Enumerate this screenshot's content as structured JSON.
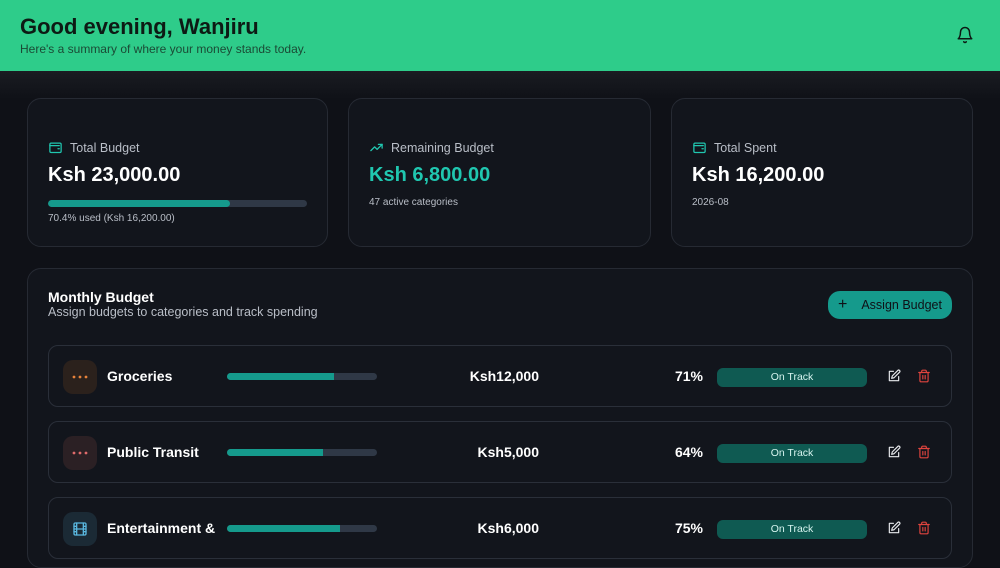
{
  "header": {
    "greeting": "Good evening, Wanjiru",
    "subtitle": "Here's a summary of where your money stands today."
  },
  "cards": [
    {
      "label": "Total Budget",
      "amount": "Ksh 23,000.00",
      "progress_pct": 70.4,
      "sub": "70.4% used (Ksh 16,200.00)",
      "icon": "wallet-icon"
    },
    {
      "label": "Remaining Budget",
      "amount": "Ksh 6,800.00",
      "sub": "47 active categories",
      "icon": "trending-up-icon"
    },
    {
      "label": "Total Spent",
      "amount": "Ksh 16,200.00",
      "sub": "2026-08",
      "icon": "wallet-icon"
    }
  ],
  "monthly": {
    "title": "Monthly Budget",
    "subtitle": "Assign budgets to categories and track spending",
    "assign_label": "Assign Budget"
  },
  "rows": [
    {
      "name": "Groceries",
      "amount": "Ksh12,000",
      "percent": "71%",
      "progress_pct": 71,
      "status": "On Track",
      "icon": "dots-icon"
    },
    {
      "name": "Public Transit",
      "amount": "Ksh5,000",
      "percent": "64%",
      "progress_pct": 64,
      "status": "On Track",
      "icon": "dots-icon"
    },
    {
      "name": "Entertainment &",
      "amount": "Ksh6,000",
      "percent": "75%",
      "progress_pct": 75,
      "status": "On Track",
      "icon": "film-icon"
    }
  ],
  "colors": {
    "header_bg": "#2ecc8a",
    "accent": "#159a8c",
    "remaining_amount": "#20c7b0",
    "delete": "#e0443e"
  }
}
